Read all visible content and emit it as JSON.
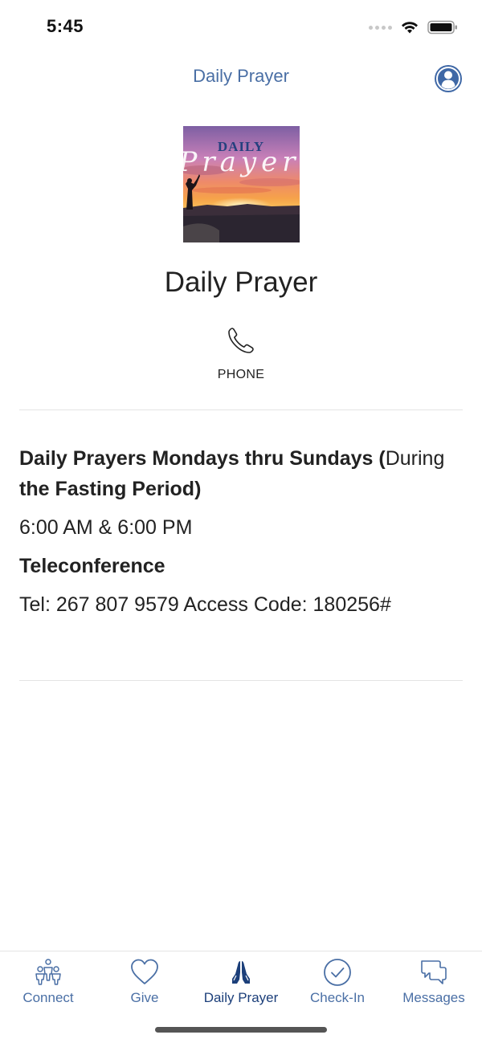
{
  "status_bar": {
    "time": "5:45"
  },
  "nav": {
    "title": "Daily Prayer",
    "profile_icon": "person-circle-icon"
  },
  "hero": {
    "image_text_top": "DAILY",
    "image_text_script": "Prayer"
  },
  "page_title": "Daily Prayer",
  "phone_action": {
    "label": "PHONE",
    "icon": "phone-icon"
  },
  "content": {
    "heading_bold": "Daily Prayers Mondays thru Sundays (",
    "heading_regular": "During",
    "heading_line2": "the Fasting Period)",
    "times": "6:00 AM & 6:00 PM",
    "subheading": "Teleconference",
    "tel": "Tel: 267 807 9579 Access Code: 180256#"
  },
  "tabs": [
    {
      "label": "Connect",
      "icon": "people-icon"
    },
    {
      "label": "Give",
      "icon": "heart-icon"
    },
    {
      "label": "Daily Prayer",
      "icon": "praying-hands-icon",
      "active": true
    },
    {
      "label": "Check-In",
      "icon": "check-circle-icon"
    },
    {
      "label": "Messages",
      "icon": "chat-bubbles-icon"
    }
  ],
  "colors": {
    "accent": "#4a6fa5",
    "active_tab": "#1c3f7a"
  }
}
